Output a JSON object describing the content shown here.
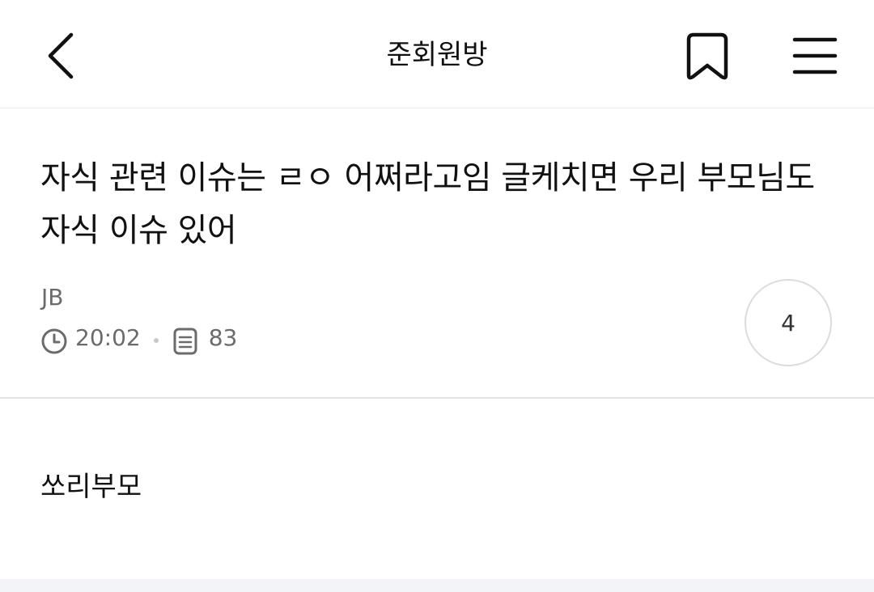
{
  "header": {
    "title": "준회원방",
    "back_icon": "chevron-left-icon",
    "bookmark_icon": "bookmark-icon",
    "menu_icon": "hamburger-menu-icon"
  },
  "post": {
    "title": "자식 관련 이슈는 ㄹㅇ 어쩌라고임 글케치면 우리 부모님도 자식 이슈 있어",
    "author": "JB",
    "time": "20:02",
    "views": "83",
    "comment_count": "4",
    "body": "쏘리부모"
  }
}
